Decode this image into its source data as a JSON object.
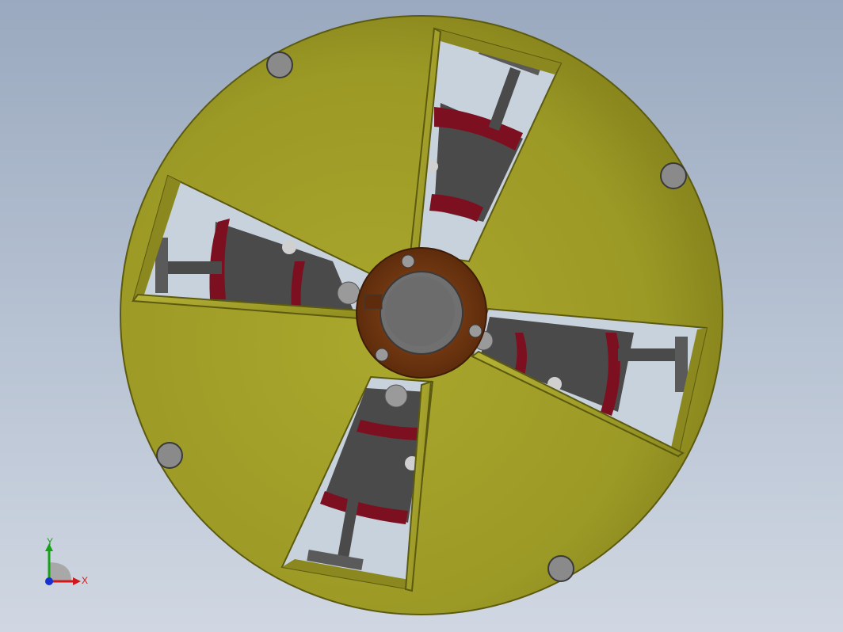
{
  "viewport": {
    "background_top": "#9aa9bf",
    "background_bottom": "#d0d7e2"
  },
  "model": {
    "disc_color": "#a4a22a",
    "disc_edge_color": "#5c5a10",
    "hub_color": "#7a3e14",
    "shaft_color": "#707070",
    "inner_dark_color": "#4a4a4a",
    "inner_red_color": "#7d1020",
    "bolt_color": "#8a8a8a",
    "slot_count": 4
  },
  "triad": {
    "x_label": "X",
    "y_label": "Y",
    "x_color": "#d01818",
    "y_color": "#18a018",
    "z_color": "#1830d0"
  }
}
